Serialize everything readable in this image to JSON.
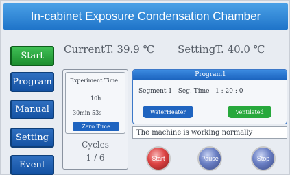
{
  "header": {
    "title": "In-cabinet Exposure Condensation Chamber"
  },
  "sidebar": {
    "items": [
      {
        "label": "Start",
        "active": true
      },
      {
        "label": "Program",
        "active": false
      },
      {
        "label": "Manual",
        "active": false
      },
      {
        "label": "Setting",
        "active": false
      },
      {
        "label": "Event",
        "active": false
      }
    ]
  },
  "status": {
    "current_label": "CurrentT.",
    "current_value": "39.9",
    "current_unit": "℃",
    "setting_label": "SettingT.",
    "setting_value": "40.0",
    "setting_unit": "℃"
  },
  "experiment": {
    "label": "Experiment Time",
    "hours": "10h",
    "min_sec": "30min  53s",
    "zero_button": "Zero Time"
  },
  "cycles": {
    "label": "Cycles",
    "value": "1  /  6"
  },
  "program": {
    "name": "Program1",
    "segment_label": "Segment",
    "segment_value": "1",
    "seg_time_label": "Seg. Time",
    "seg_time_value": "1  : 20 : 0",
    "water_heater": "WaterHeater",
    "ventilated": "Ventilated"
  },
  "message": "The machine is working normally",
  "controls": {
    "start": "Start",
    "pause": "Pause",
    "stop": "Stop"
  },
  "colors": {
    "title_bar": "#1f74c9",
    "active_button": "#1d8f2f",
    "nav_button": "#1452a3",
    "ventilated": "#27a83c",
    "start_button": "#d44444"
  }
}
